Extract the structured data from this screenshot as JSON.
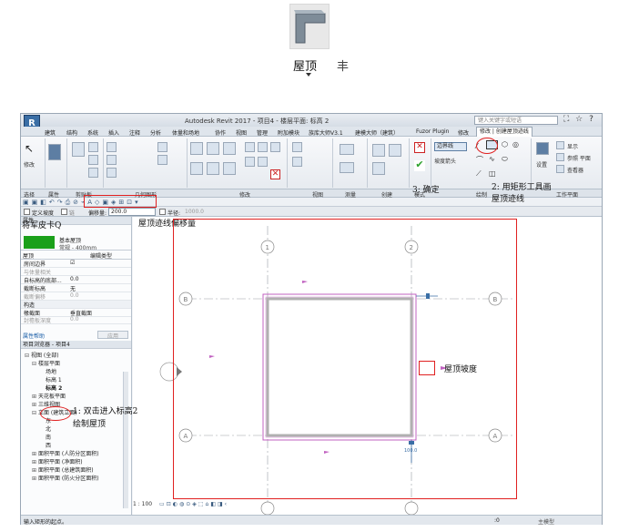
{
  "top_tool": {
    "label": "屋顶",
    "label_suffix": "丰",
    "icon": "roof-icon"
  },
  "app": {
    "logo": "R",
    "title": "Autodesk Revit 2017 -   项目4 - 楼层平面: 标高 2",
    "search_placeholder": "键入关键字或短语",
    "window_icons": "⛶ ☆ ?"
  },
  "menu": [
    "建筑",
    "结构",
    "系统",
    "插入",
    "注释",
    "分析",
    "体量和场地",
    "协作",
    "视图",
    "管理",
    "附加模块",
    "族库大师V3.1",
    "建模大师（建筑）",
    "Fuzor Plugin",
    "修改",
    "修改 | 创建屋顶迹线"
  ],
  "ribbon": {
    "modify_label": "修改",
    "boundary_line": "边界线",
    "slope_arrow": "坡度箭头",
    "set_label": "设置",
    "show_label": "显示",
    "ref_plane_label": "参照 平面",
    "viewer_label": "查看器",
    "panels": [
      "选择",
      "属性",
      "剪贴板",
      "几何图形",
      "修改",
      "视图",
      "测量",
      "创建",
      "模式",
      "绘制",
      "工作平面"
    ]
  },
  "options": {
    "define_slope": "定义坡度",
    "chain": "链",
    "offset_label": "偏移量:",
    "offset_value": "200.0",
    "radius_label": "半径:",
    "radius_value": "1000.0"
  },
  "properties": {
    "header": "属性",
    "type_family": "基本屋顶",
    "type_name": "常规 - 400mm",
    "category": "屋顶",
    "edit_type": "编辑类型",
    "rows": [
      {
        "k": "房间边界",
        "v": "☑"
      },
      {
        "k": "与体量相关",
        "v": ""
      },
      {
        "k": "自标高的底部...",
        "v": "0.0"
      },
      {
        "k": "截断标高",
        "v": "无"
      },
      {
        "k": "截断偏移",
        "v": "0.0"
      }
    ],
    "section": "构造",
    "rows2": [
      {
        "k": "椽截面",
        "v": "垂直截面"
      },
      {
        "k": "封檐板深度",
        "v": "0.0"
      },
      {
        "k": "最大屋脊高度",
        "v": "0.0"
      }
    ],
    "help": "属性帮助",
    "apply": "应用"
  },
  "browser": {
    "header": "项目浏览器 - 项目4",
    "items": [
      {
        "t": "视图 (全部)",
        "lvl": 0,
        "sign": "⊟"
      },
      {
        "t": "楼层平面",
        "lvl": 1,
        "sign": "⊟"
      },
      {
        "t": "场地",
        "lvl": 2,
        "sign": ""
      },
      {
        "t": "标高 1",
        "lvl": 2,
        "sign": ""
      },
      {
        "t": "标高 2",
        "lvl": 2,
        "sign": ""
      },
      {
        "t": "天花板平面",
        "lvl": 1,
        "sign": "⊞"
      },
      {
        "t": "三维视图",
        "lvl": 1,
        "sign": "⊞"
      },
      {
        "t": "立面 (建筑立面)",
        "lvl": 1,
        "sign": "⊟"
      },
      {
        "t": "东",
        "lvl": 2,
        "sign": ""
      },
      {
        "t": "北",
        "lvl": 2,
        "sign": ""
      },
      {
        "t": "南",
        "lvl": 2,
        "sign": ""
      },
      {
        "t": "西",
        "lvl": 2,
        "sign": ""
      },
      {
        "t": "面积平面 (人防分区面积)",
        "lvl": 1,
        "sign": "⊞"
      },
      {
        "t": "面积平面 (净面积)",
        "lvl": 1,
        "sign": "⊞"
      },
      {
        "t": "面积平面 (总建筑面积)",
        "lvl": 1,
        "sign": "⊞"
      },
      {
        "t": "面积平面 (防火分区面积)",
        "lvl": 1,
        "sign": "⊞"
      }
    ]
  },
  "canvas": {
    "grid_top": [
      "1",
      "2"
    ],
    "grid_side": [
      "B",
      "A"
    ],
    "dim_value": "100.0",
    "scale": "1 : 100"
  },
  "status": {
    "text": "输入矩形的起点。",
    "zero": ":0",
    "model": "主模型"
  },
  "annotations": {
    "rename_tab": "将军皮卡Q",
    "offset_note": "屋顶迹线偏移量",
    "step1_a": "1: 双击进入标高2",
    "step1_b": "绘制屋顶",
    "step2_a": "2: 用矩形工具画",
    "step2_b": "屋顶迹线",
    "step3": "3: 确定",
    "slope_note": "屋顶坡度"
  },
  "colors": {
    "accent_red": "#e02020",
    "material_green": "#1aa01a",
    "roof_line": "#c060c0"
  }
}
